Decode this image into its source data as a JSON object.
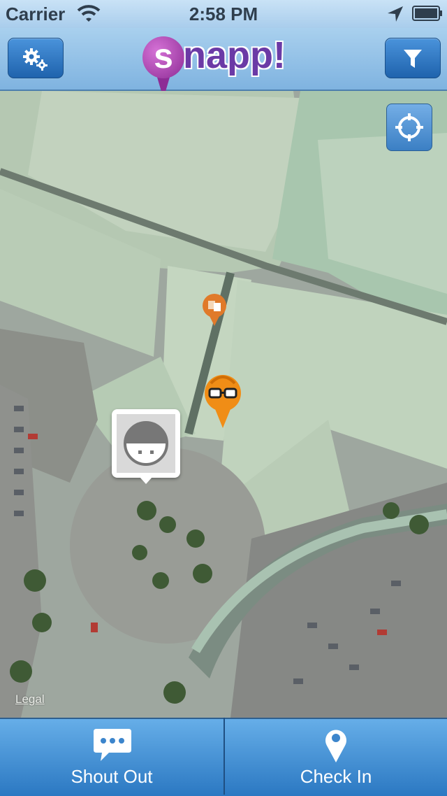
{
  "status_bar": {
    "carrier": "Carrier",
    "time": "2:58 PM",
    "icons": [
      "wifi-icon",
      "location-arrow-icon",
      "battery-icon"
    ]
  },
  "nav_bar": {
    "logo_letter": "s",
    "logo_rest": "napp!",
    "left_button_icon": "gear-icon",
    "right_button_icon": "filter-icon"
  },
  "map": {
    "legal_text": "Legal",
    "locate_button_icon": "crosshair-icon",
    "pins": [
      {
        "type": "shopping-bag-pin",
        "color": "#e07a2a"
      },
      {
        "type": "glasses-face-pin",
        "color": "#f08d16"
      }
    ],
    "user_callout_icon": "user-avatar-icon"
  },
  "tab_bar": {
    "tabs": [
      {
        "label": "Shout Out",
        "icon": "speech-bubble-icon"
      },
      {
        "label": "Check In",
        "icon": "map-pin-icon"
      }
    ]
  },
  "colors": {
    "nav_bar": "#8dbde6",
    "button_blue": "#2c73c0",
    "logo_purple": "#6b3aa6",
    "tab_bar": "#4a94d6"
  }
}
